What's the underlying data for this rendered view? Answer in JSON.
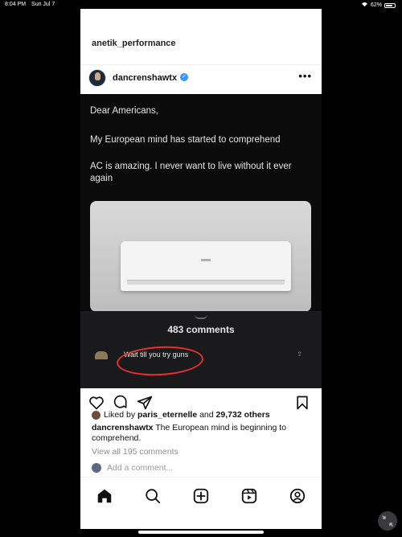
{
  "status_bar": {
    "time": "8:04 PM",
    "date": "Sun Jul 7",
    "battery": "62%"
  },
  "profile": {
    "name": "anetik_performance"
  },
  "post": {
    "username": "dancrenshawtx",
    "tweet": {
      "line1": "Dear Americans,",
      "line2": "My European mind has started to comprehend",
      "line3": "AC is amazing. I never want to live without it ever again"
    },
    "sheet": {
      "comments_count": "483 comments",
      "top_comment": "Wait till you try guns"
    },
    "likes": {
      "prefix": "Liked by",
      "user": "paris_eternelle",
      "joiner": "and",
      "count": "29,732 others"
    },
    "caption": {
      "user": "dancrenshawtx",
      "text": "The European mind is beginning to comprehend."
    },
    "view_all": "View all 195 comments",
    "add_comment": "Add a comment..."
  },
  "icons": {
    "like": "heart-icon",
    "comment": "comment-icon",
    "share": "share-icon",
    "save": "bookmark-icon",
    "home": "home-icon",
    "search": "search-icon",
    "create": "create-icon",
    "reels": "reels-icon",
    "profile": "profile-icon"
  },
  "colors": {
    "accent_red": "#e3322f",
    "verified_blue": "#3897f0"
  }
}
